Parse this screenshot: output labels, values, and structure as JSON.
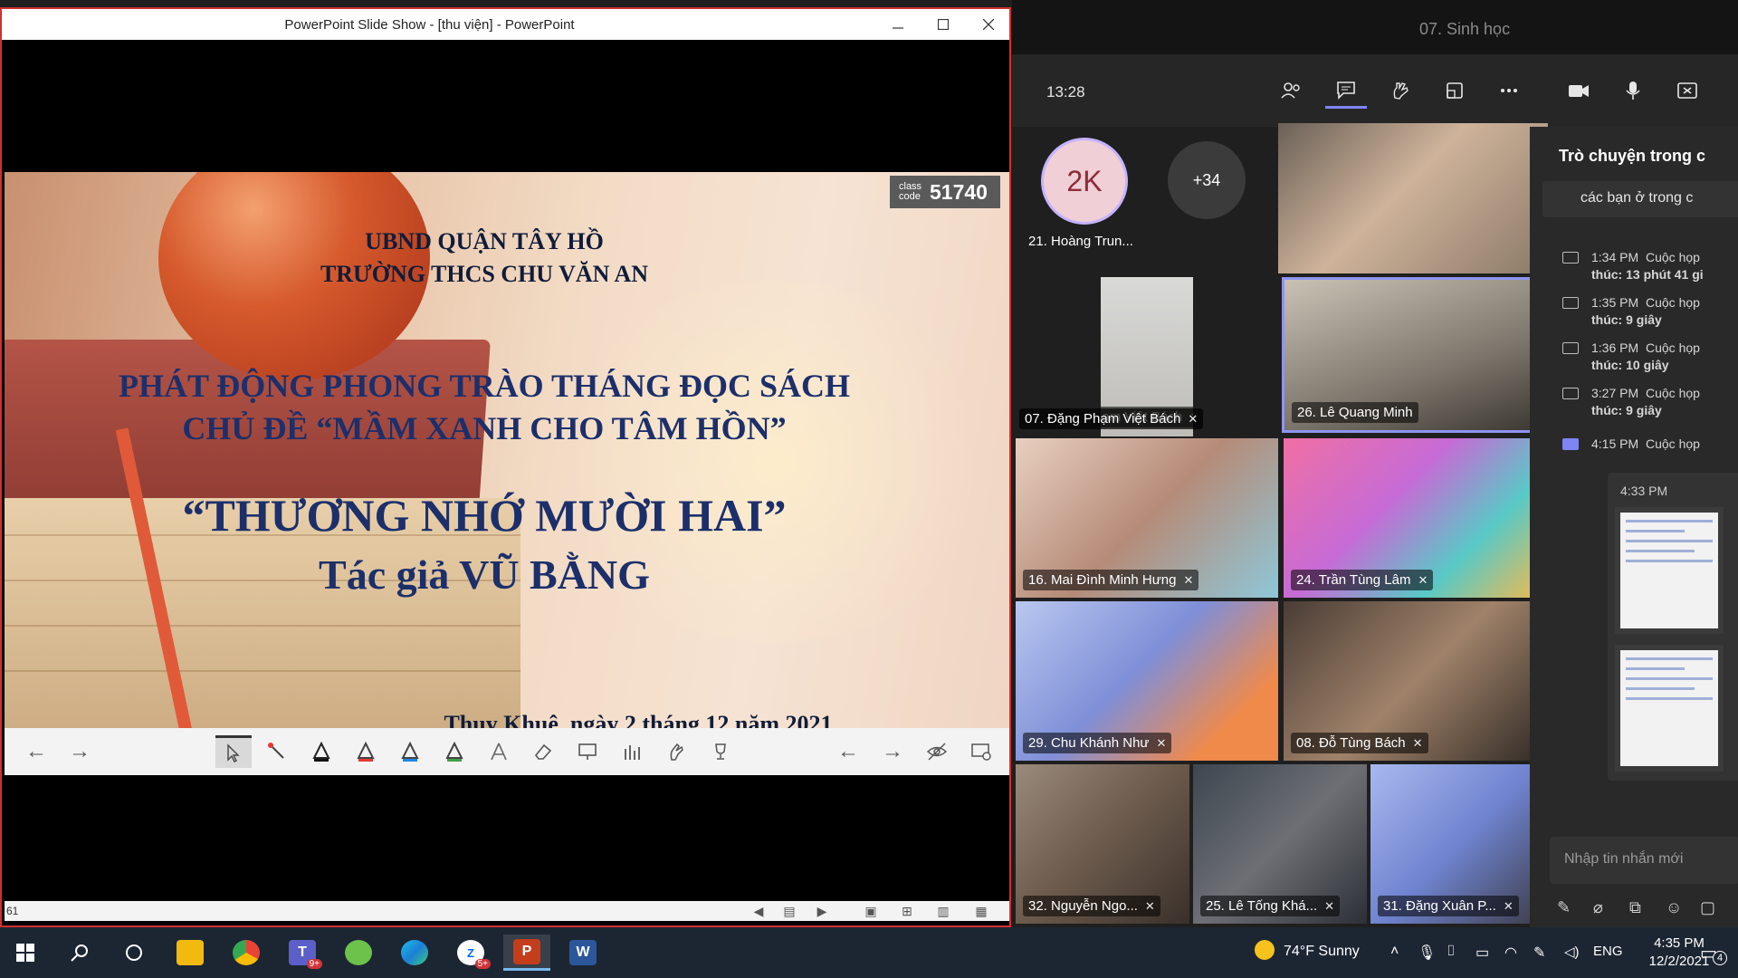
{
  "powerpoint": {
    "title": "PowerPoint Slide Show - [thu viện] - PowerPoint",
    "slide": {
      "class_label_top": "class",
      "class_label_bottom": "code",
      "class_code": "51740",
      "line1": "UBND QUẬN TÂY HỒ",
      "line2": "TRƯỜNG THCS CHU VĂN AN",
      "line3": "PHÁT ĐỘNG PHONG TRÀO THÁNG ĐỌC SÁCH",
      "line4": "CHỦ ĐỀ “MẦM XANH CHO TÂM HỒN”",
      "line5": "“THƯƠNG NHỚ MƯỜI HAI”",
      "line6": "Tác giả VŨ BẰNG",
      "line7": "Thuỵ Khuê, ngày 2 tháng 12 năm 2021"
    },
    "status_page": "61"
  },
  "teams": {
    "meeting_title": "07. Sinh học",
    "clock": "13:28",
    "avatar_initials": "2K",
    "avatar_name": "21. Hoàng Trun...",
    "overflow_count": "+34",
    "participants": [
      "07. Đặng Phạm Việt Bách",
      "26. Lê Quang Minh",
      "16. Mai Đình Minh Hưng",
      "24. Trần Tùng Lâm",
      "29. Chu Khánh Như",
      "08. Đỗ Tùng Bách",
      "32. Nguyễn Ngo...",
      "25. Lê Tống Khá...",
      "31. Đặng Xuân P..."
    ],
    "chat": {
      "title": "Trò chuyện trong c",
      "first_message": "các bạn ở trong c",
      "events": [
        {
          "time": "1:34 PM",
          "text": "Cuộc họp",
          "detail": "thúc: 13 phút 41 gi"
        },
        {
          "time": "1:35 PM",
          "text": "Cuộc họp",
          "detail": "thúc: 9 giây"
        },
        {
          "time": "1:36 PM",
          "text": "Cuộc họp",
          "detail": "thúc: 10 giây"
        },
        {
          "time": "3:27 PM",
          "text": "Cuộc họp",
          "detail": "thúc: 9 giây"
        },
        {
          "time": "4:15 PM",
          "text": "Cuộc họp",
          "detail": ""
        }
      ],
      "image_time": "4:33 PM",
      "input_placeholder": "Nhập tin nhắn mới"
    }
  },
  "taskbar": {
    "teams_badge": "9+",
    "zalo_badge": "5+",
    "weather": "74°F  Sunny",
    "language": "ENG",
    "time": "4:35 PM",
    "date": "12/2/2021",
    "notifications": "4"
  }
}
